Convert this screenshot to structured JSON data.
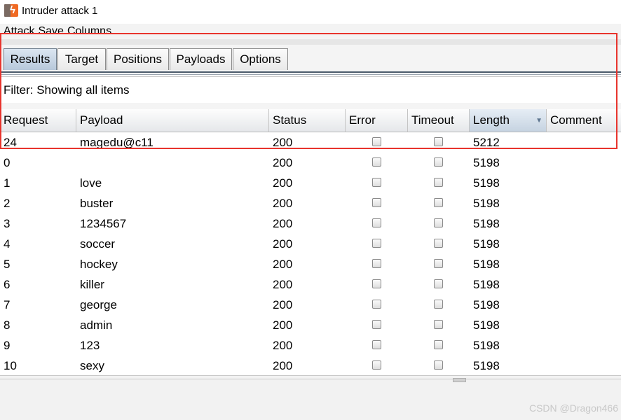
{
  "window": {
    "title": "Intruder attack 1"
  },
  "menu": [
    "Attack",
    "Save",
    "Columns"
  ],
  "tabs": [
    {
      "label": "Results",
      "active": true
    },
    {
      "label": "Target",
      "active": false
    },
    {
      "label": "Positions",
      "active": false
    },
    {
      "label": "Payloads",
      "active": false
    },
    {
      "label": "Options",
      "active": false
    }
  ],
  "filter": {
    "text": "Filter: Showing all items"
  },
  "table": {
    "columns": [
      "Request",
      "Payload",
      "Status",
      "Error",
      "Timeout",
      "Length",
      "Comment"
    ],
    "sorted_column": "Length",
    "rows": [
      {
        "request": "24",
        "payload": "magedu@c11",
        "status": "200",
        "error": false,
        "timeout": false,
        "length": "5212",
        "comment": ""
      },
      {
        "request": "0",
        "payload": "",
        "status": "200",
        "error": false,
        "timeout": false,
        "length": "5198",
        "comment": ""
      },
      {
        "request": "1",
        "payload": "love",
        "status": "200",
        "error": false,
        "timeout": false,
        "length": "5198",
        "comment": ""
      },
      {
        "request": "2",
        "payload": "buster",
        "status": "200",
        "error": false,
        "timeout": false,
        "length": "5198",
        "comment": ""
      },
      {
        "request": "3",
        "payload": "1234567",
        "status": "200",
        "error": false,
        "timeout": false,
        "length": "5198",
        "comment": ""
      },
      {
        "request": "4",
        "payload": "soccer",
        "status": "200",
        "error": false,
        "timeout": false,
        "length": "5198",
        "comment": ""
      },
      {
        "request": "5",
        "payload": "hockey",
        "status": "200",
        "error": false,
        "timeout": false,
        "length": "5198",
        "comment": ""
      },
      {
        "request": "6",
        "payload": "killer",
        "status": "200",
        "error": false,
        "timeout": false,
        "length": "5198",
        "comment": ""
      },
      {
        "request": "7",
        "payload": "george",
        "status": "200",
        "error": false,
        "timeout": false,
        "length": "5198",
        "comment": ""
      },
      {
        "request": "8",
        "payload": "admin",
        "status": "200",
        "error": false,
        "timeout": false,
        "length": "5198",
        "comment": ""
      },
      {
        "request": "9",
        "payload": "123",
        "status": "200",
        "error": false,
        "timeout": false,
        "length": "5198",
        "comment": ""
      },
      {
        "request": "10",
        "payload": "sexy",
        "status": "200",
        "error": false,
        "timeout": false,
        "length": "5198",
        "comment": ""
      }
    ]
  },
  "colors": {
    "highlight": "#e8342d",
    "active_tab": "#b7c8da",
    "app_icon": "#f06a23"
  },
  "watermark": "CSDN @Dragon466"
}
